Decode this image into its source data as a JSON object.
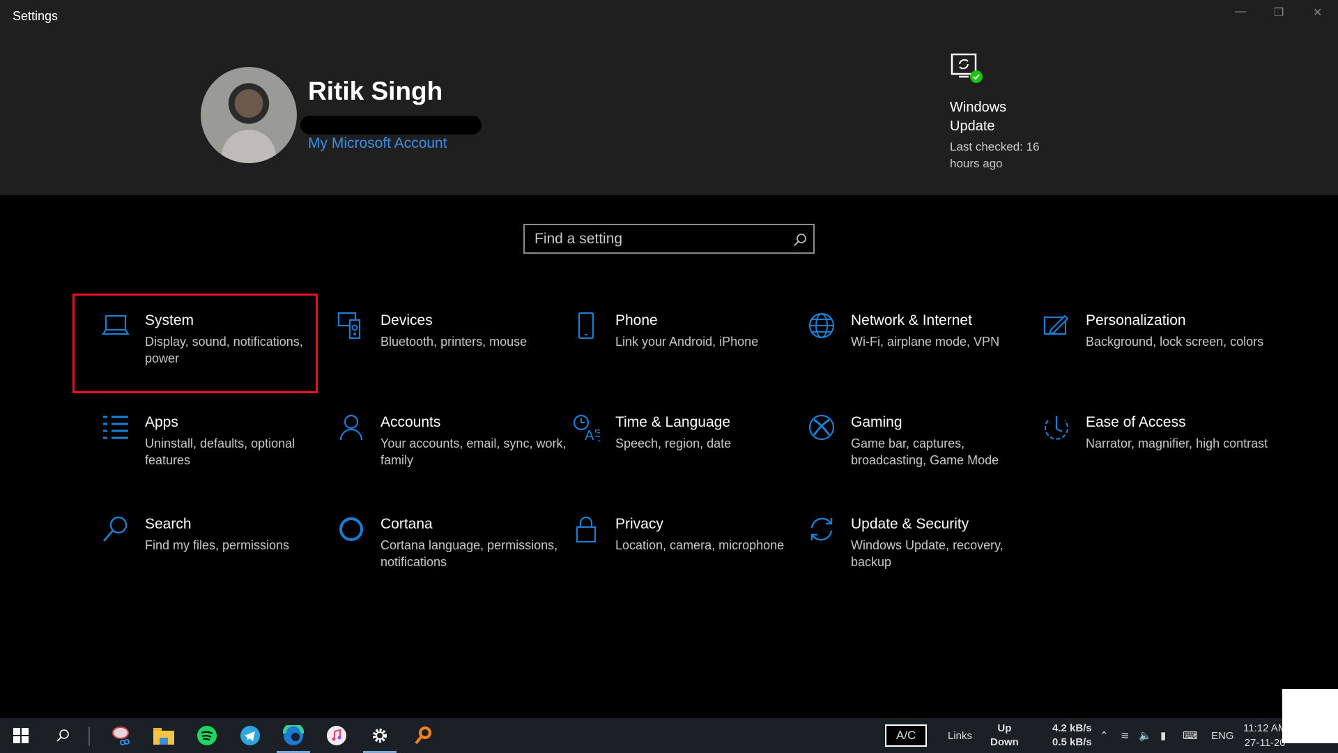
{
  "window": {
    "title": "Settings"
  },
  "profile": {
    "name": "Ritik Singh",
    "account_link": "My Microsoft Account"
  },
  "windows_update": {
    "title": "Windows Update",
    "status": "Last checked: 16 hours ago"
  },
  "search": {
    "placeholder": "Find a setting"
  },
  "accent_color": "#1a7fd4",
  "highlight_color": "#e81123",
  "tiles": [
    {
      "icon": "laptop-icon",
      "title": "System",
      "desc": "Display, sound, notifications, power"
    },
    {
      "icon": "devices-icon",
      "title": "Devices",
      "desc": "Bluetooth, printers, mouse"
    },
    {
      "icon": "phone-icon",
      "title": "Phone",
      "desc": "Link your Android, iPhone"
    },
    {
      "icon": "globe-icon",
      "title": "Network & Internet",
      "desc": "Wi-Fi, airplane mode, VPN"
    },
    {
      "icon": "personalization-icon",
      "title": "Personalization",
      "desc": "Background, lock screen, colors"
    },
    {
      "icon": "apps-list-icon",
      "title": "Apps",
      "desc": "Uninstall, defaults, optional features"
    },
    {
      "icon": "person-icon",
      "title": "Accounts",
      "desc": "Your accounts, email, sync, work, family"
    },
    {
      "icon": "time-language-icon",
      "title": "Time & Language",
      "desc": "Speech, region, date"
    },
    {
      "icon": "xbox-icon",
      "title": "Gaming",
      "desc": "Game bar, captures, broadcasting, Game Mode"
    },
    {
      "icon": "ease-of-access-icon",
      "title": "Ease of Access",
      "desc": "Narrator, magnifier, high contrast"
    },
    {
      "icon": "search-icon",
      "title": "Search",
      "desc": "Find my files, permissions"
    },
    {
      "icon": "cortana-icon",
      "title": "Cortana",
      "desc": "Cortana language, permissions, notifications"
    },
    {
      "icon": "lock-icon",
      "title": "Privacy",
      "desc": "Location, camera, microphone"
    },
    {
      "icon": "sync-icon",
      "title": "Update & Security",
      "desc": "Windows Update, recovery, backup"
    }
  ],
  "taskbar": {
    "apps": [
      "start-icon",
      "search-icon",
      "snip-sketch-icon",
      "file-explorer-icon",
      "spotify-icon",
      "telegram-icon",
      "edge-icon",
      "itunes-icon",
      "settings-icon",
      "search-everything-icon"
    ],
    "power": "A/C",
    "links": "Links",
    "up_label": "Up",
    "down_label": "Down",
    "up_speed": "4.2 kB/s",
    "down_speed": "0.5 kB/s",
    "language": "ENG",
    "time": "11:12 AM",
    "date": "27-11-20"
  }
}
